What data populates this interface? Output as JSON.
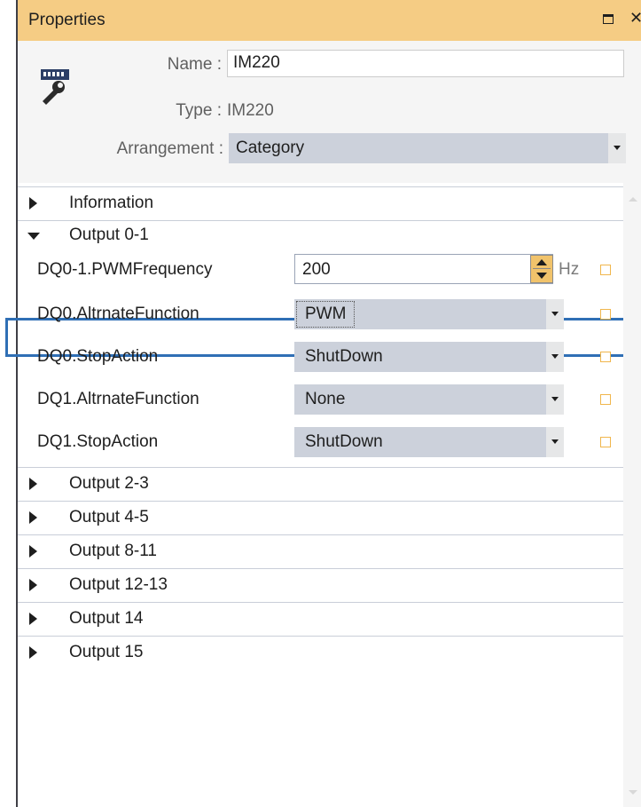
{
  "window": {
    "title": "Properties"
  },
  "header": {
    "name_label": "Name :",
    "name_value": "IM220",
    "type_label": "Type :",
    "type_value": "IM220",
    "arrangement_label": "Arrangement :",
    "arrangement_value": "Category"
  },
  "categories": {
    "information": "Information",
    "output_0_1": "Output 0-1",
    "output_2_3": "Output 2-3",
    "output_4_5": "Output 4-5",
    "output_8_11": "Output 8-11",
    "output_12_13": "Output 12-13",
    "output_14": "Output 14",
    "output_15": "Output 15"
  },
  "properties": {
    "pwm_frequency": {
      "name": "DQ0-1.PWMFrequency",
      "value": "200",
      "unit": "Hz"
    },
    "dq0_alt": {
      "name": "DQ0.AltrnateFunction",
      "value": "PWM"
    },
    "dq0_stop": {
      "name": "DQ0.StopAction",
      "value": "ShutDown"
    },
    "dq1_alt": {
      "name": "DQ1.AltrnateFunction",
      "value": "None"
    },
    "dq1_stop": {
      "name": "DQ1.StopAction",
      "value": "ShutDown"
    }
  },
  "colors": {
    "title_bar": "#f5cc84",
    "highlight": "#2f6fb5",
    "dropdown_bg": "#ccd1db",
    "checkbox": "#f0b64c"
  }
}
